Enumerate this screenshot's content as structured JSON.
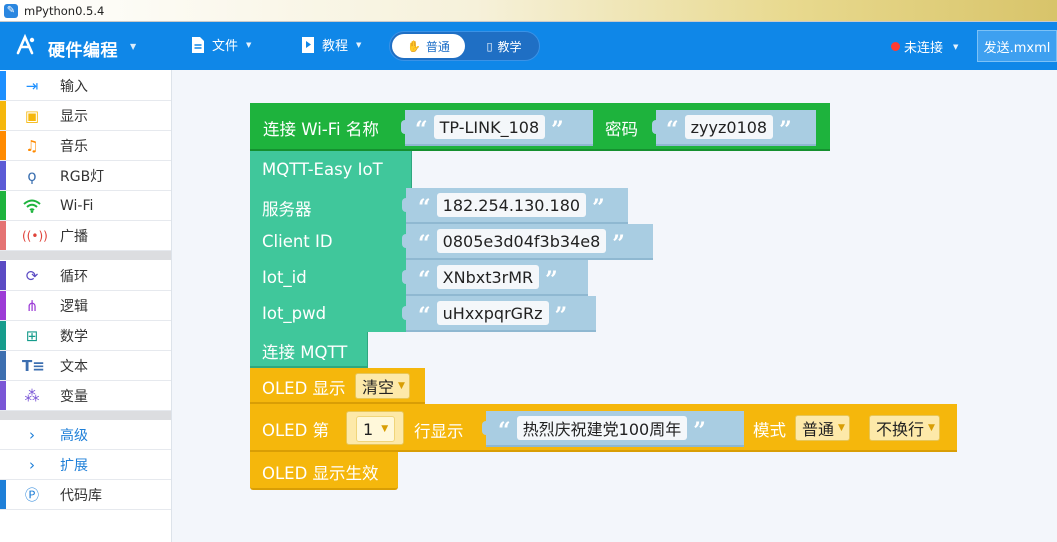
{
  "window": {
    "title": "mPython0.5.4",
    "app_icon": "mpython-app-icon"
  },
  "toolbar": {
    "brand": "硬件编程",
    "file": "文件",
    "tutorial": "教程",
    "mode_normal": "普通",
    "mode_teach": "教学",
    "connection": "未连接",
    "send": "发送.mxml",
    "colors": {
      "bar": "#0f87e8",
      "status_dot": "#ff3b30"
    }
  },
  "sidebar": {
    "items": [
      {
        "label": "输入",
        "icon": "input-arrow-icon",
        "color": "#1e90ff"
      },
      {
        "label": "显示",
        "icon": "display-icon",
        "color": "#f5b70c"
      },
      {
        "label": "音乐",
        "icon": "music-note-icon",
        "color": "#ff8a00"
      },
      {
        "label": "RGB灯",
        "icon": "bulb-icon",
        "color": "#5b5bd6"
      },
      {
        "label": "Wi-Fi",
        "icon": "wifi-icon",
        "color": "#1eb33d"
      },
      {
        "label": "广播",
        "icon": "broadcast-icon",
        "color": "#e57373"
      },
      {
        "label": "循环",
        "icon": "loop-icon",
        "color": "#5b4bc4"
      },
      {
        "label": "逻辑",
        "icon": "logic-tree-icon",
        "color": "#9c3bd6"
      },
      {
        "label": "数学",
        "icon": "calculator-icon",
        "color": "#169c8c"
      },
      {
        "label": "文本",
        "icon": "text-icon",
        "color": "#3d6fb0"
      },
      {
        "label": "变量",
        "icon": "variable-icon",
        "color": "#7a56d6"
      },
      {
        "label": "高级",
        "icon": "chevron-right-icon",
        "color": "#1e7fd8"
      },
      {
        "label": "扩展",
        "icon": "chevron-right-icon",
        "color": "#1e7fd8"
      },
      {
        "label": "代码库",
        "icon": "code-library-icon",
        "color": "#1e7fd8"
      }
    ]
  },
  "blocks": {
    "wifi": {
      "label": "连接 Wi-Fi 名称",
      "ssid": "TP-LINK_108",
      "pwd_label": "密码",
      "pwd": "zyyz0108"
    },
    "mqtt": {
      "title": "MQTT-Easy IoT",
      "server_label": "服务器",
      "server": "182.254.130.180",
      "client_label": "Client ID",
      "client": "0805e3d04f3b34e8",
      "iot_id_label": "Iot_id",
      "iot_id": "XNbxt3rMR",
      "iot_pwd_label": "Iot_pwd",
      "iot_pwd": "uHxxpqrGRz"
    },
    "connect_mqtt": "连接 MQTT",
    "oled_show": {
      "label": "OLED 显示",
      "option": "清空"
    },
    "oled_line": {
      "label": "OLED 第",
      "line": "1",
      "row_label": "行显示",
      "text": "热烈庆祝建党100周年",
      "mode_label": "模式",
      "mode": "普通",
      "wrap": "不换行"
    },
    "oled_apply": "OLED 显示生效",
    "quote_open": "“",
    "quote_close": "”"
  }
}
